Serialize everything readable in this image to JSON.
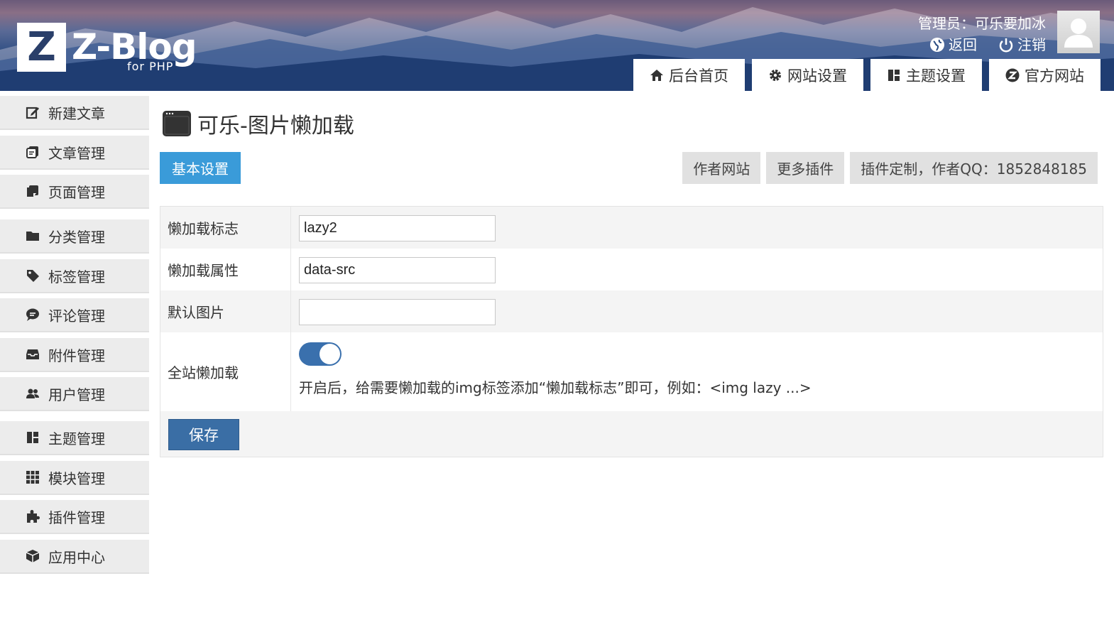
{
  "header": {
    "logo_letter": "Z",
    "logo_title": "Z-Blog",
    "logo_sub": "for PHP",
    "admin_text": "管理员：可乐要加冰",
    "back_label": "返回",
    "logout_label": "注销"
  },
  "topnav": [
    {
      "label": "后台首页",
      "icon": "home-icon"
    },
    {
      "label": "网站设置",
      "icon": "gear-icon"
    },
    {
      "label": "主题设置",
      "icon": "layout-icon"
    },
    {
      "label": "官方网站",
      "icon": "zblog-icon"
    }
  ],
  "sidebar": {
    "items": [
      {
        "label": "新建文章",
        "icon": "edit-icon"
      },
      {
        "label": "文章管理",
        "icon": "articles-icon"
      },
      {
        "label": "页面管理",
        "icon": "page-icon"
      },
      {
        "label": "分类管理",
        "icon": "folder-icon"
      },
      {
        "label": "标签管理",
        "icon": "tag-icon"
      },
      {
        "label": "评论管理",
        "icon": "comment-icon"
      },
      {
        "label": "附件管理",
        "icon": "inbox-icon"
      },
      {
        "label": "用户管理",
        "icon": "users-icon"
      },
      {
        "label": "主题管理",
        "icon": "layout-icon"
      },
      {
        "label": "模块管理",
        "icon": "grid-icon"
      },
      {
        "label": "插件管理",
        "icon": "puzzle-icon"
      },
      {
        "label": "应用中心",
        "icon": "box-icon"
      }
    ]
  },
  "main": {
    "title": "可乐-图片懒加载",
    "tab_basic": "基本设置",
    "right_buttons": [
      "作者网站",
      "更多插件",
      "插件定制，作者QQ：1852848185"
    ],
    "form": {
      "lazy_flag_label": "懒加载标志",
      "lazy_flag_value": "lazy2",
      "lazy_attr_label": "懒加载属性",
      "lazy_attr_value": "data-src",
      "default_img_label": "默认图片",
      "default_img_value": "",
      "sitewide_label": "全站懒加载",
      "sitewide_enabled": true,
      "sitewide_hint": "开启后，给需要懒加载的img标签添加“懒加载标志”即可，例如：<img lazy ...>",
      "save_label": "保存"
    }
  },
  "colors": {
    "accent": "#3a9bd9",
    "save": "#3a6ea5",
    "toggle_on": "#3a70ad"
  }
}
